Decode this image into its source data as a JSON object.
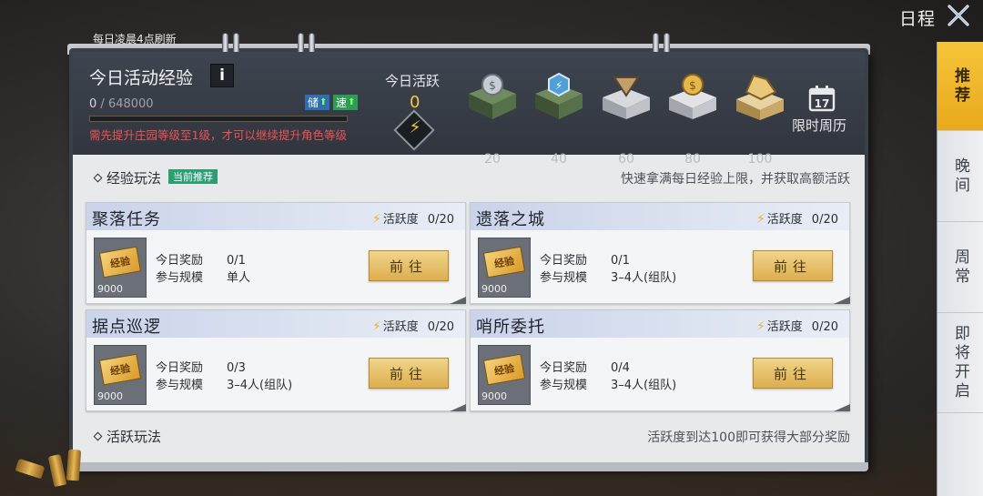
{
  "header": {
    "title": "日程"
  },
  "tabs": [
    {
      "label": "推荐",
      "active": true
    },
    {
      "label": "晚间",
      "active": false
    },
    {
      "label": "周常",
      "active": false
    },
    {
      "label": "即将开启",
      "active": false
    }
  ],
  "notebook": {
    "refresh_note": "每日凌晨4点刷新",
    "exp": {
      "title": "今日活动经验",
      "info_label": "i",
      "current": "0",
      "max": "648000",
      "progress": 0,
      "boost1": "储",
      "boost2": "速",
      "warning": "需先提升庄园等级至1级，才可以继续提升角色等级"
    },
    "activity": {
      "label": "今日活跃",
      "value": "0",
      "thresholds": [
        "20",
        "40",
        "60",
        "80",
        "100"
      ]
    },
    "calendar": {
      "day": "17",
      "label": "限时周历"
    },
    "sections": {
      "exp_play": {
        "title": "经验玩法",
        "badge": "当前推荐",
        "note": "快速拿满每日经验上限，并获取高额活跃"
      },
      "active_play": {
        "title": "活跃玩法",
        "note": "活跃度到达100即可获得大部分奖励"
      }
    },
    "cards": [
      {
        "name": "聚落任务",
        "act_label": "活跃度",
        "act_count": "0/20",
        "reward_label": "今日奖励",
        "reward_value": "0/1",
        "scale_label": "参与规模",
        "scale_value": "单人",
        "thumb_text": "经验",
        "thumb_num": "9000",
        "button": "前往"
      },
      {
        "name": "遗落之城",
        "act_label": "活跃度",
        "act_count": "0/20",
        "reward_label": "今日奖励",
        "reward_value": "0/1",
        "scale_label": "参与规模",
        "scale_value": "3–4人(组队)",
        "thumb_text": "经验",
        "thumb_num": "9000",
        "button": "前往"
      },
      {
        "name": "据点巡逻",
        "act_label": "活跃度",
        "act_count": "0/20",
        "reward_label": "今日奖励",
        "reward_value": "0/3",
        "scale_label": "参与规模",
        "scale_value": "3–4人(组队)",
        "thumb_text": "经验",
        "thumb_num": "9000",
        "button": "前往"
      },
      {
        "name": "哨所委托",
        "act_label": "活跃度",
        "act_count": "0/20",
        "reward_label": "今日奖励",
        "reward_value": "0/4",
        "scale_label": "参与规模",
        "scale_value": "3–4人(组队)",
        "thumb_text": "经验",
        "thumb_num": "9000",
        "button": "前往"
      }
    ]
  },
  "colors": {
    "accent": "#e9a91c",
    "warning": "#ef5353",
    "activity": "#f3c642"
  },
  "icons": [
    "close-icon",
    "info-icon",
    "bolt-icon",
    "chest-icon",
    "calendar-icon",
    "ticket-icon"
  ]
}
